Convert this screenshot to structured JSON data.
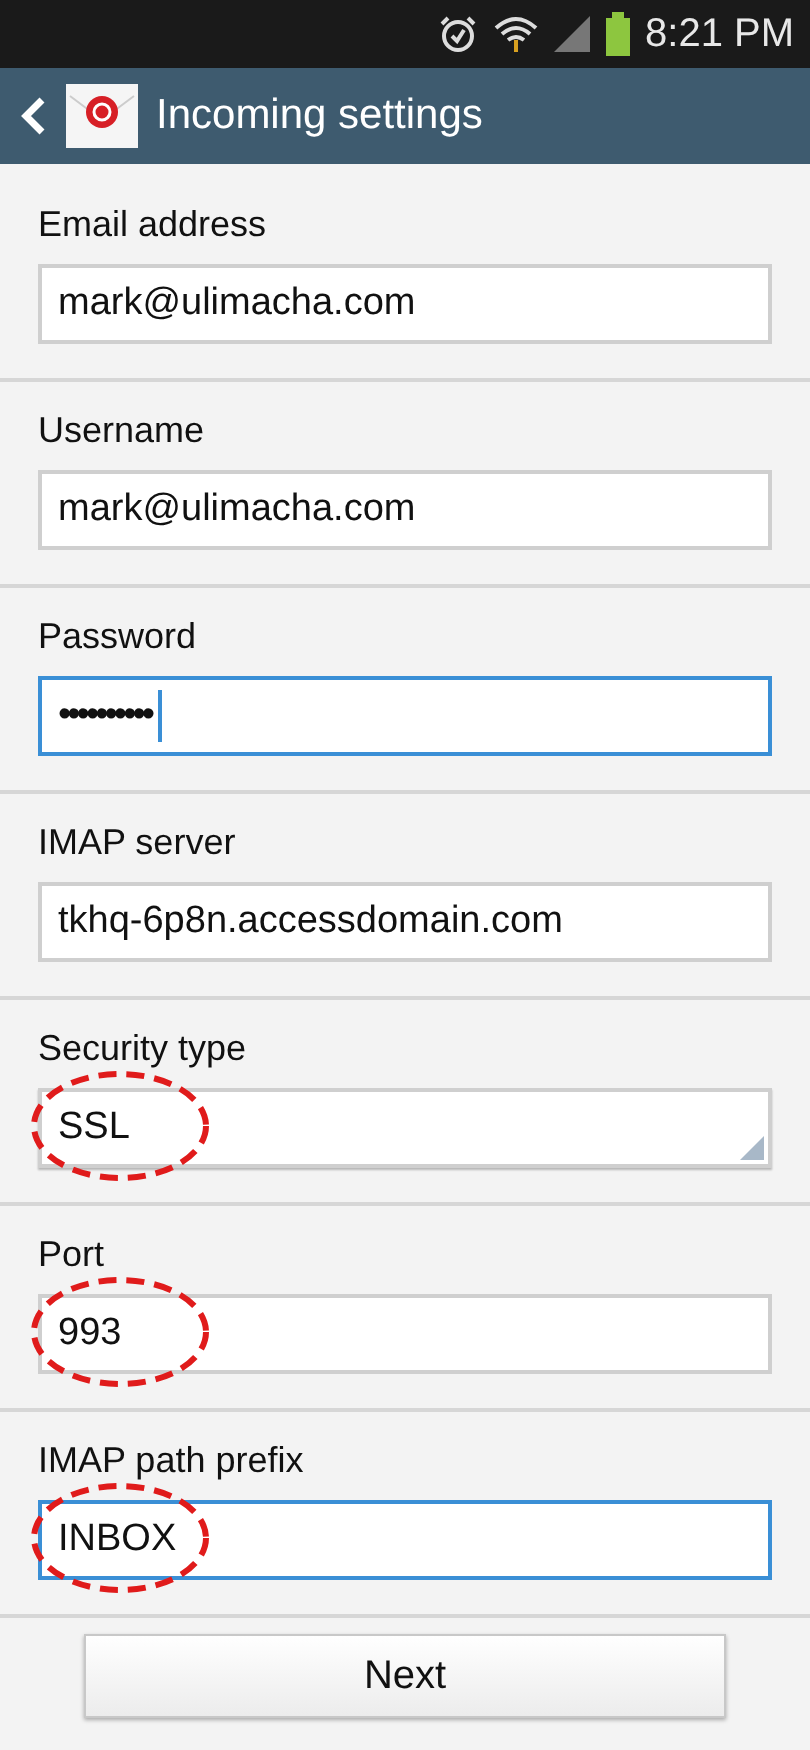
{
  "status_bar": {
    "time": "8:21 PM"
  },
  "header": {
    "title": "Incoming settings"
  },
  "fields": [
    {
      "label": "Email address",
      "kind": "text",
      "value": "mark@ulimacha.com",
      "focused": false,
      "annotated": false
    },
    {
      "label": "Username",
      "kind": "text",
      "value": "mark@ulimacha.com",
      "focused": false,
      "annotated": false
    },
    {
      "label": "Password",
      "kind": "password",
      "value": "••••••••••",
      "focused": true,
      "annotated": false
    },
    {
      "label": "IMAP server",
      "kind": "text",
      "value": "tkhq-6p8n.accessdomain.com",
      "focused": false,
      "annotated": false
    },
    {
      "label": "Security type",
      "kind": "select",
      "value": "SSL",
      "focused": false,
      "annotated": true
    },
    {
      "label": "Port",
      "kind": "text",
      "value": "993",
      "focused": false,
      "annotated": true
    },
    {
      "label": "IMAP path prefix",
      "kind": "text",
      "value": "INBOX",
      "focused": true,
      "annotated": true
    }
  ],
  "next_button": "Next"
}
